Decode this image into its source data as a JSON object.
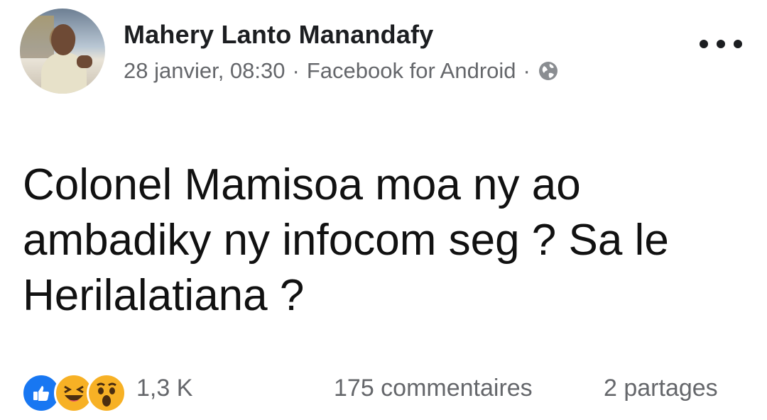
{
  "post": {
    "author": "Mahery Lanto Manandafy",
    "date": "28 janvier, 08:30",
    "separator": "·",
    "source": "Facebook for Android",
    "audience_icon": "globe-icon",
    "text": "Colonel Mamisoa moa ny ao ambadiky ny infocom seg ? Sa le Herilalatiana ?"
  },
  "stats": {
    "reaction_icons": [
      "like-icon",
      "haha-icon",
      "wow-icon"
    ],
    "reactions": "1,3 K",
    "comments": "175 commentaires",
    "shares": "2 partages"
  },
  "colors": {
    "text_primary": "#1c1e21",
    "text_secondary": "#65676b",
    "like_blue": "#1877f2",
    "emoji_yellow": "#f7b125"
  }
}
